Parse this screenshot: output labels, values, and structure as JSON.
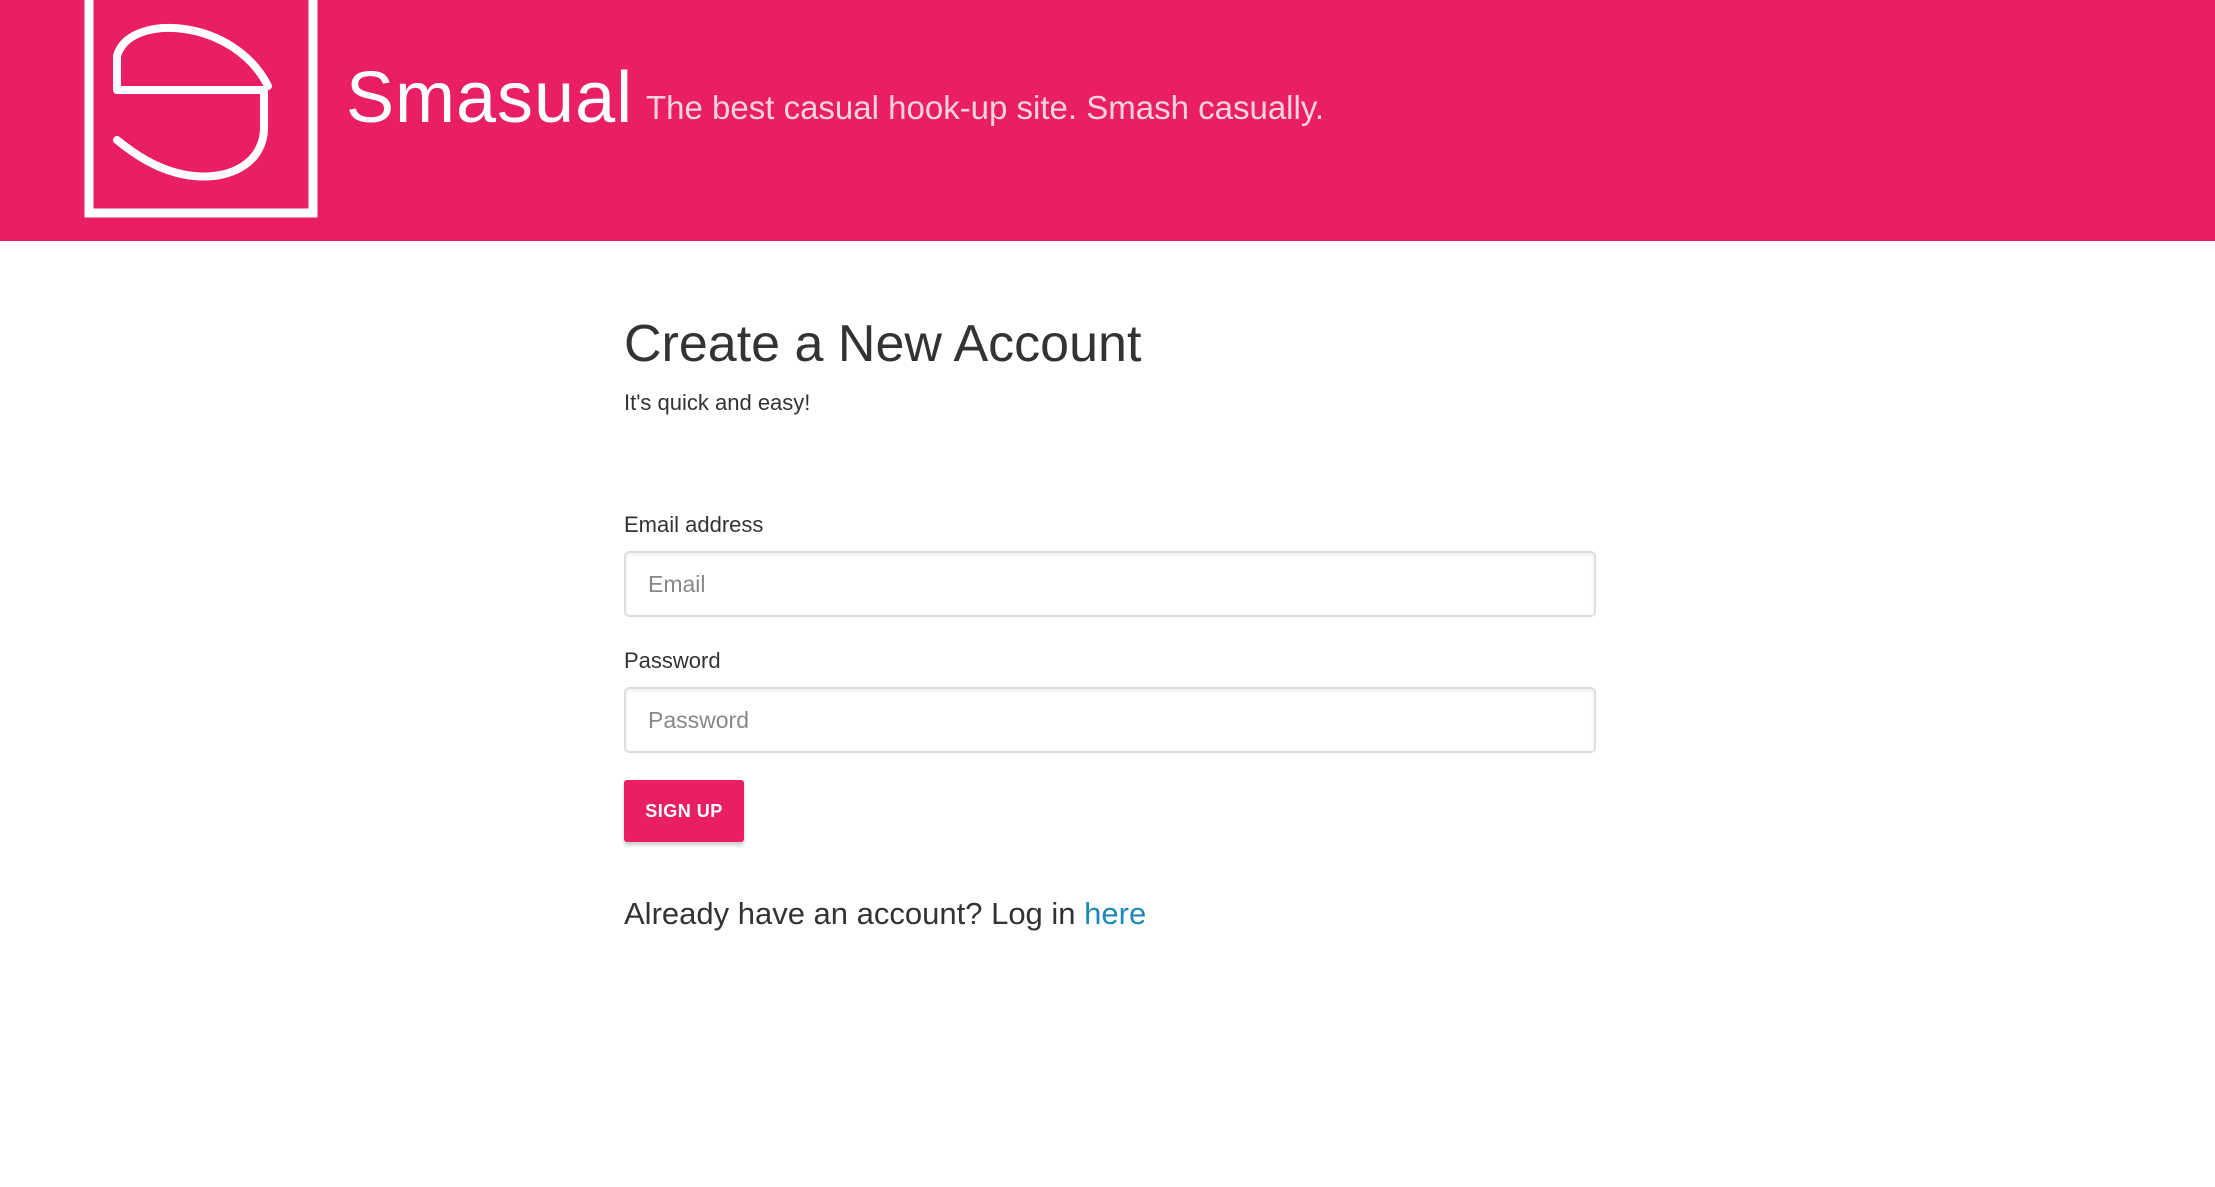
{
  "header": {
    "brand": "Smasual",
    "tagline": "The best casual hook-up site. Smash casually.",
    "logo_icon": "s-logo-icon",
    "background_color": "#E91E63"
  },
  "form": {
    "title": "Create a New Account",
    "subtitle": "It's quick and easy!",
    "email_label": "Email address",
    "email_placeholder": "Email",
    "email_value": "",
    "password_label": "Password",
    "password_placeholder": "Password",
    "password_value": "",
    "submit_label": "SIGN UP",
    "accent_color": "#E91E63"
  },
  "footer": {
    "login_prompt": "Already have an account? Log in",
    "login_link": "here",
    "link_color": "#1E88B8"
  }
}
